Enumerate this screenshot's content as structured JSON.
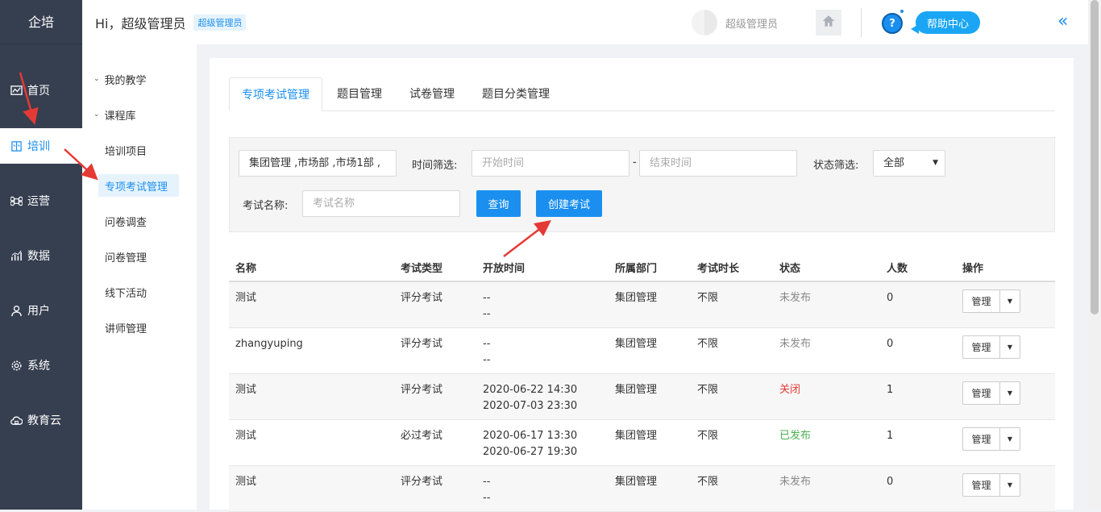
{
  "app": {
    "logo": "企培"
  },
  "nav": {
    "items": [
      {
        "label": "首页",
        "icon": "chart-line-icon"
      },
      {
        "label": "培训",
        "icon": "book-icon",
        "active": true
      },
      {
        "label": "运营",
        "icon": "command-icon"
      },
      {
        "label": "数据",
        "icon": "bar-chart-icon"
      },
      {
        "label": "用户",
        "icon": "user-icon"
      },
      {
        "label": "系统",
        "icon": "gear-icon"
      },
      {
        "label": "教育云",
        "icon": "cloud-icon"
      }
    ]
  },
  "subnav": {
    "groups": [
      "我的教学",
      "课程库"
    ],
    "items": [
      "培训项目",
      "专项考试管理",
      "问卷调查",
      "问卷管理",
      "线下活动",
      "讲师管理"
    ],
    "active": "专项考试管理"
  },
  "header": {
    "greeting": "Hi，超级管理员",
    "role_badge": "超级管理员",
    "username": "超级管理员",
    "help_label": "帮助中心",
    "help_icon_text": "?",
    "collapse_icon": "«"
  },
  "tabs": [
    "专项考试管理",
    "题目管理",
    "试卷管理",
    "题目分类管理"
  ],
  "filter": {
    "dept_value": "集团管理 ,市场部 ,市场1部 ,",
    "time_label": "时间筛选:",
    "start_placeholder": "开始时间",
    "dash": "-",
    "end_placeholder": "结束时间",
    "status_label": "状态筛选:",
    "status_value": "全部",
    "name_label": "考试名称:",
    "name_placeholder": "考试名称",
    "query_label": "查询",
    "create_label": "创建考试"
  },
  "table": {
    "columns": [
      "名称",
      "考试类型",
      "开放时间",
      "所属部门",
      "考试时长",
      "状态",
      "人数",
      "操作"
    ],
    "rows": [
      {
        "name": "测试",
        "type": "评分考试",
        "start": "--",
        "end": "--",
        "dept": "集团管理",
        "duration": "不限",
        "status": "未发布",
        "count": "0",
        "op": "管理"
      },
      {
        "name": "zhangyuping",
        "type": "评分考试",
        "start": "--",
        "end": "--",
        "dept": "集团管理",
        "duration": "不限",
        "status": "未发布",
        "count": "0",
        "op": "管理"
      },
      {
        "name": "测试",
        "type": "评分考试",
        "start": "2020-06-22 14:30",
        "end": "2020-07-03 23:30",
        "dept": "集团管理",
        "duration": "不限",
        "status": "关闭",
        "count": "1",
        "op": "管理"
      },
      {
        "name": "测试",
        "type": "必过考试",
        "start": "2020-06-17 13:30",
        "end": "2020-06-27 19:30",
        "dept": "集团管理",
        "duration": "不限",
        "status": "已发布",
        "count": "1",
        "op": "管理"
      },
      {
        "name": "测试",
        "type": "评分考试",
        "start": "--",
        "end": "--",
        "dept": "集团管理",
        "duration": "不限",
        "status": "未发布",
        "count": "0",
        "op": "管理"
      }
    ]
  },
  "colors": {
    "accent": "#1a8ff0",
    "sidebar": "#363f50",
    "annotation_arrow": "#e53935",
    "status_closed": "#e53935",
    "status_published": "#4caf50"
  }
}
